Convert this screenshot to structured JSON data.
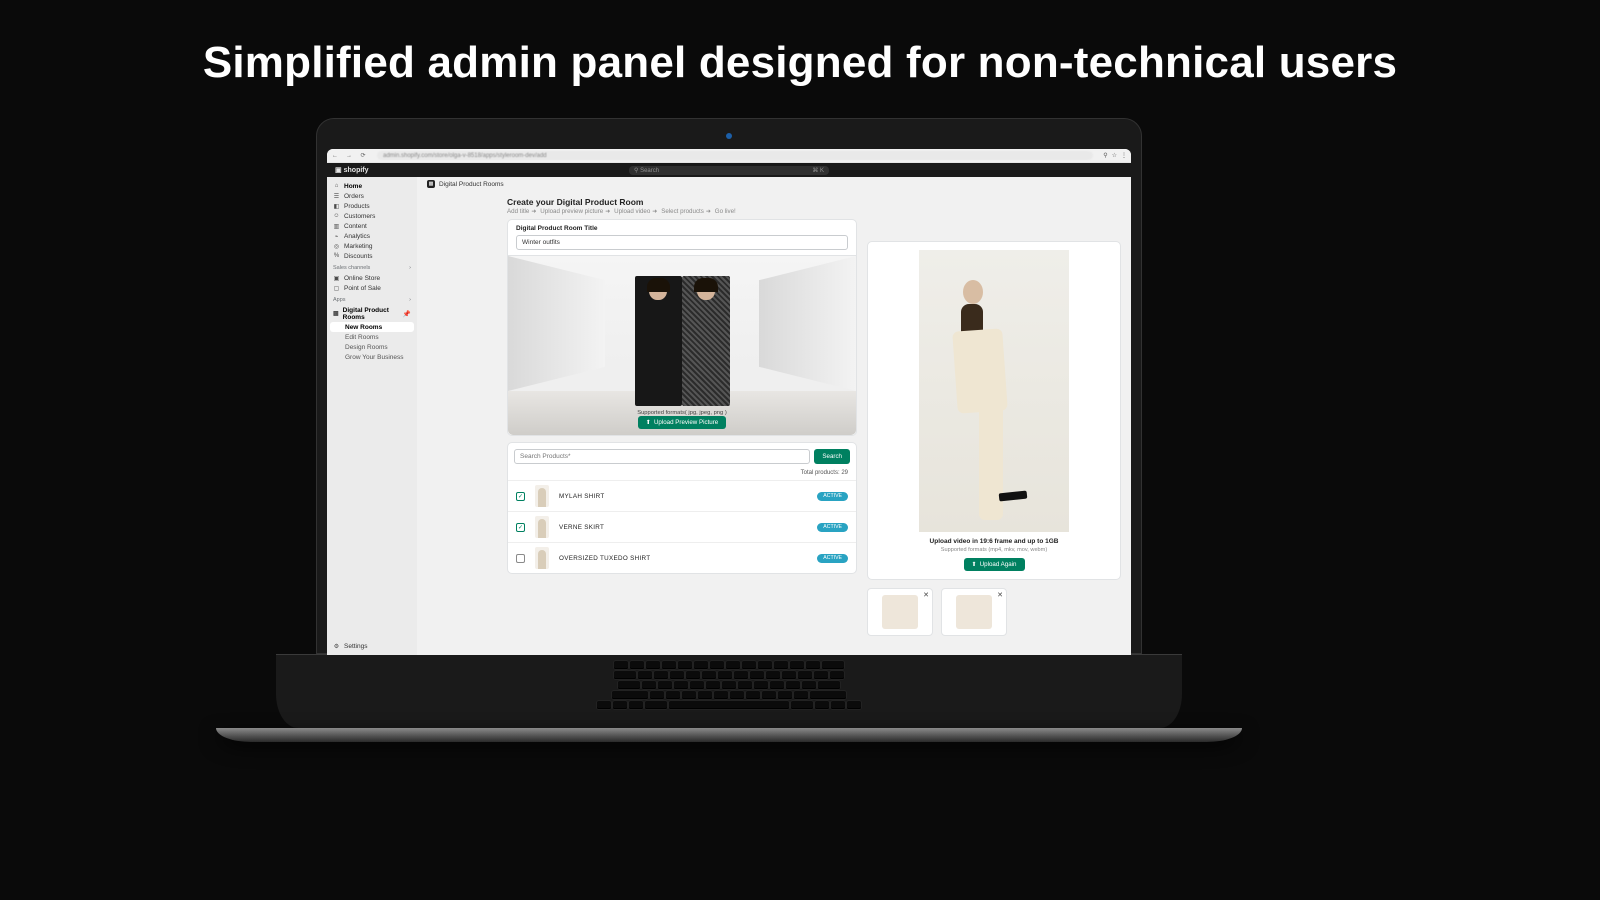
{
  "hero": "Simplified admin panel designed for non-technical users",
  "browser": {
    "url": "admin.shopify.com/store/olga-v-8518/apps/styleroom-dev/add"
  },
  "header": {
    "brand": "shopify",
    "search_placeholder": "Search",
    "shortcut": "⌘ K"
  },
  "sidebar": {
    "items": [
      {
        "icon": "⌂",
        "label": "Home"
      },
      {
        "icon": "☰",
        "label": "Orders"
      },
      {
        "icon": "◧",
        "label": "Products"
      },
      {
        "icon": "☺",
        "label": "Customers"
      },
      {
        "icon": "▥",
        "label": "Content"
      },
      {
        "icon": "⌁",
        "label": "Analytics"
      },
      {
        "icon": "◎",
        "label": "Marketing"
      },
      {
        "icon": "%",
        "label": "Discounts"
      }
    ],
    "channels_label": "Sales channels",
    "channels": [
      {
        "icon": "▣",
        "label": "Online Store"
      },
      {
        "icon": "▢",
        "label": "Point of Sale"
      }
    ],
    "apps_label": "Apps",
    "apps": {
      "name": "Digital Product Rooms",
      "sub": [
        "New Rooms",
        "Edit Rooms",
        "Design Rooms",
        "Grow Your Business"
      ]
    },
    "settings": "Settings"
  },
  "crumb": "Digital Product Rooms",
  "page": {
    "title": "Create your Digital Product Room",
    "steps": [
      "Add title",
      "Upload preview picture",
      "Upload video",
      "Select products",
      "Go live!"
    ],
    "title_label": "Digital Product Room Title",
    "title_value": "Winter outfits",
    "supported_img": "Supported formats( jpg, jpeg, png )",
    "upload_btn": "Upload Preview Picture",
    "search_placeholder": "Search Products*",
    "search_btn": "Search",
    "total_label": "Total products:",
    "total": 29,
    "products": [
      {
        "checked": true,
        "name": "MYLAH SHIRT",
        "status": "ACTIVE"
      },
      {
        "checked": true,
        "name": "VERNE SKIRT",
        "status": "ACTIVE"
      },
      {
        "checked": false,
        "name": "OVERSIZED TUXEDO SHIRT",
        "status": "ACTIVE"
      }
    ]
  },
  "video": {
    "title": "Upload video in 19:6 frame and up to 1GB",
    "sub": "Supported formats (mp4, mkv, mov, webm)",
    "btn": "Upload Again"
  }
}
